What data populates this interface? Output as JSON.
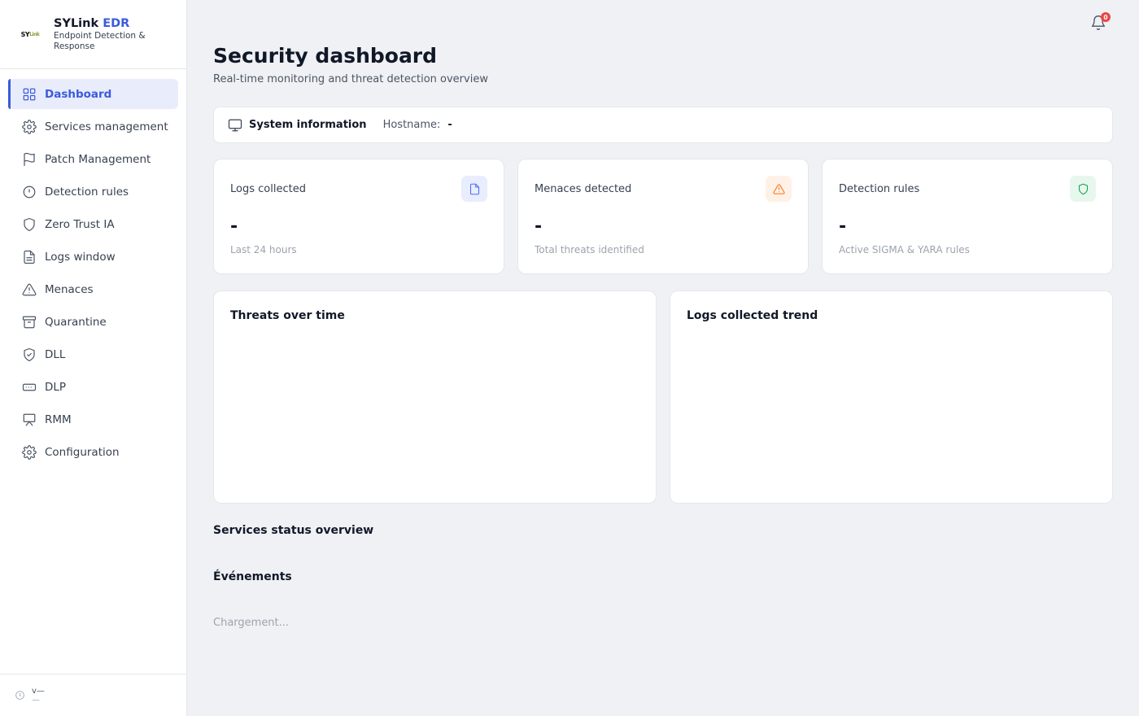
{
  "brand": {
    "logo_text": "SY",
    "logo_small": "Link",
    "name": "SYLink",
    "name_accent": "EDR",
    "subtitle": "Endpoint Detection & Response"
  },
  "sidebar": {
    "items": [
      {
        "label": "Dashboard",
        "icon": "grid-icon",
        "active": true
      },
      {
        "label": "Services management",
        "icon": "gear-icon"
      },
      {
        "label": "Patch Management",
        "icon": "flag-icon"
      },
      {
        "label": "Detection rules",
        "icon": "alert-circle-icon"
      },
      {
        "label": "Zero Trust IA",
        "icon": "shield-icon"
      },
      {
        "label": "Logs window",
        "icon": "file-text-icon"
      },
      {
        "label": "Menaces",
        "icon": "warning-triangle-icon"
      },
      {
        "label": "Quarantine",
        "icon": "archive-icon"
      },
      {
        "label": "DLL",
        "icon": "shield-check-icon"
      },
      {
        "label": "DLP",
        "icon": "card-dots-icon"
      },
      {
        "label": "RMM",
        "icon": "presentation-icon"
      },
      {
        "label": "Configuration",
        "icon": "gear-icon"
      }
    ],
    "footer": {
      "version": "v—",
      "sub": "—"
    }
  },
  "header": {
    "notification_count": "0",
    "title": "Security dashboard",
    "subtitle": "Real-time monitoring and threat detection overview"
  },
  "system_info": {
    "title": "System information",
    "hostname_label": "Hostname:",
    "hostname_value": "-"
  },
  "stats": [
    {
      "title": "Logs collected",
      "value": "-",
      "sub": "Last 24 hours",
      "icon": "file-icon",
      "color": "#4f6ef2",
      "bg": "#e8edff"
    },
    {
      "title": "Menaces detected",
      "value": "-",
      "sub": "Total threats identified",
      "icon": "warning-icon",
      "color": "#f97316",
      "bg": "#fff1e6"
    },
    {
      "title": "Detection rules",
      "value": "-",
      "sub": "Active SIGMA & YARA rules",
      "icon": "shield-icon",
      "color": "#16a34a",
      "bg": "#e7f7ee"
    }
  ],
  "panels": {
    "threats_title": "Threats over time",
    "logs_title": "Logs collected trend"
  },
  "sections": {
    "services_title": "Services status overview",
    "events_title": "Événements",
    "loading": "Chargement..."
  }
}
